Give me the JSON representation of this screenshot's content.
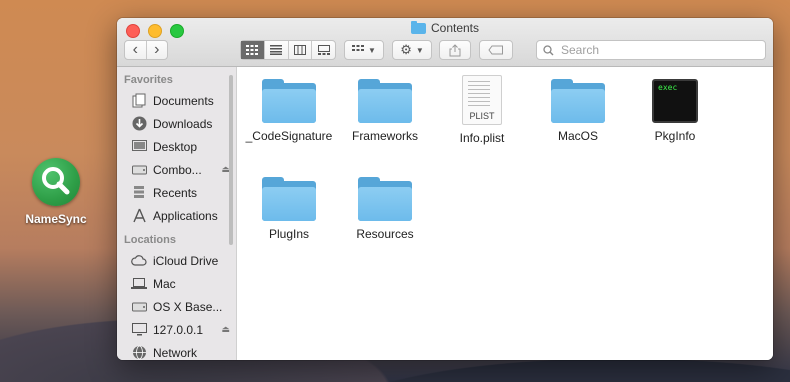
{
  "desktop": {
    "app_label": "NameSync"
  },
  "window": {
    "title": "Contents"
  },
  "toolbar": {
    "back_glyph": "‹",
    "forward_glyph": "›",
    "view_modes": [
      "icon-view-icon",
      "list-view-icon",
      "column-view-icon",
      "gallery-view-icon"
    ],
    "active_view": "icon-view-icon",
    "search_placeholder": "Search"
  },
  "sidebar": {
    "favorites_heading": "Favorites",
    "favorites": [
      {
        "label": "Documents",
        "icon": "documents-icon"
      },
      {
        "label": "Downloads",
        "icon": "downloads-icon"
      },
      {
        "label": "Desktop",
        "icon": "desktop-icon"
      },
      {
        "label": "Combo...",
        "icon": "disk-icon",
        "eject": true
      },
      {
        "label": "Recents",
        "icon": "recents-icon"
      },
      {
        "label": "Applications",
        "icon": "applications-icon"
      }
    ],
    "locations_heading": "Locations",
    "locations": [
      {
        "label": "iCloud Drive",
        "icon": "cloud-icon"
      },
      {
        "label": "Mac",
        "icon": "laptop-icon"
      },
      {
        "label": "OS X Base...",
        "icon": "disk-icon"
      },
      {
        "label": "127.0.0.1",
        "icon": "display-icon",
        "eject": true
      },
      {
        "label": "Network",
        "icon": "globe-icon"
      }
    ]
  },
  "files": [
    {
      "name": "_CodeSignature",
      "type": "folder"
    },
    {
      "name": "Frameworks",
      "type": "folder"
    },
    {
      "name": "Info.plist",
      "type": "plist",
      "badge": "PLIST"
    },
    {
      "name": "MacOS",
      "type": "folder"
    },
    {
      "name": "PkgInfo",
      "type": "exec",
      "badge": "exec"
    },
    {
      "name": "PlugIns",
      "type": "folder"
    },
    {
      "name": "Resources",
      "type": "folder"
    }
  ],
  "colors": {
    "folder": "#6dbbeb",
    "app_icon": "#2e9e47",
    "close": "#fe5f57",
    "minimize": "#febc2e",
    "zoom": "#28c840"
  }
}
